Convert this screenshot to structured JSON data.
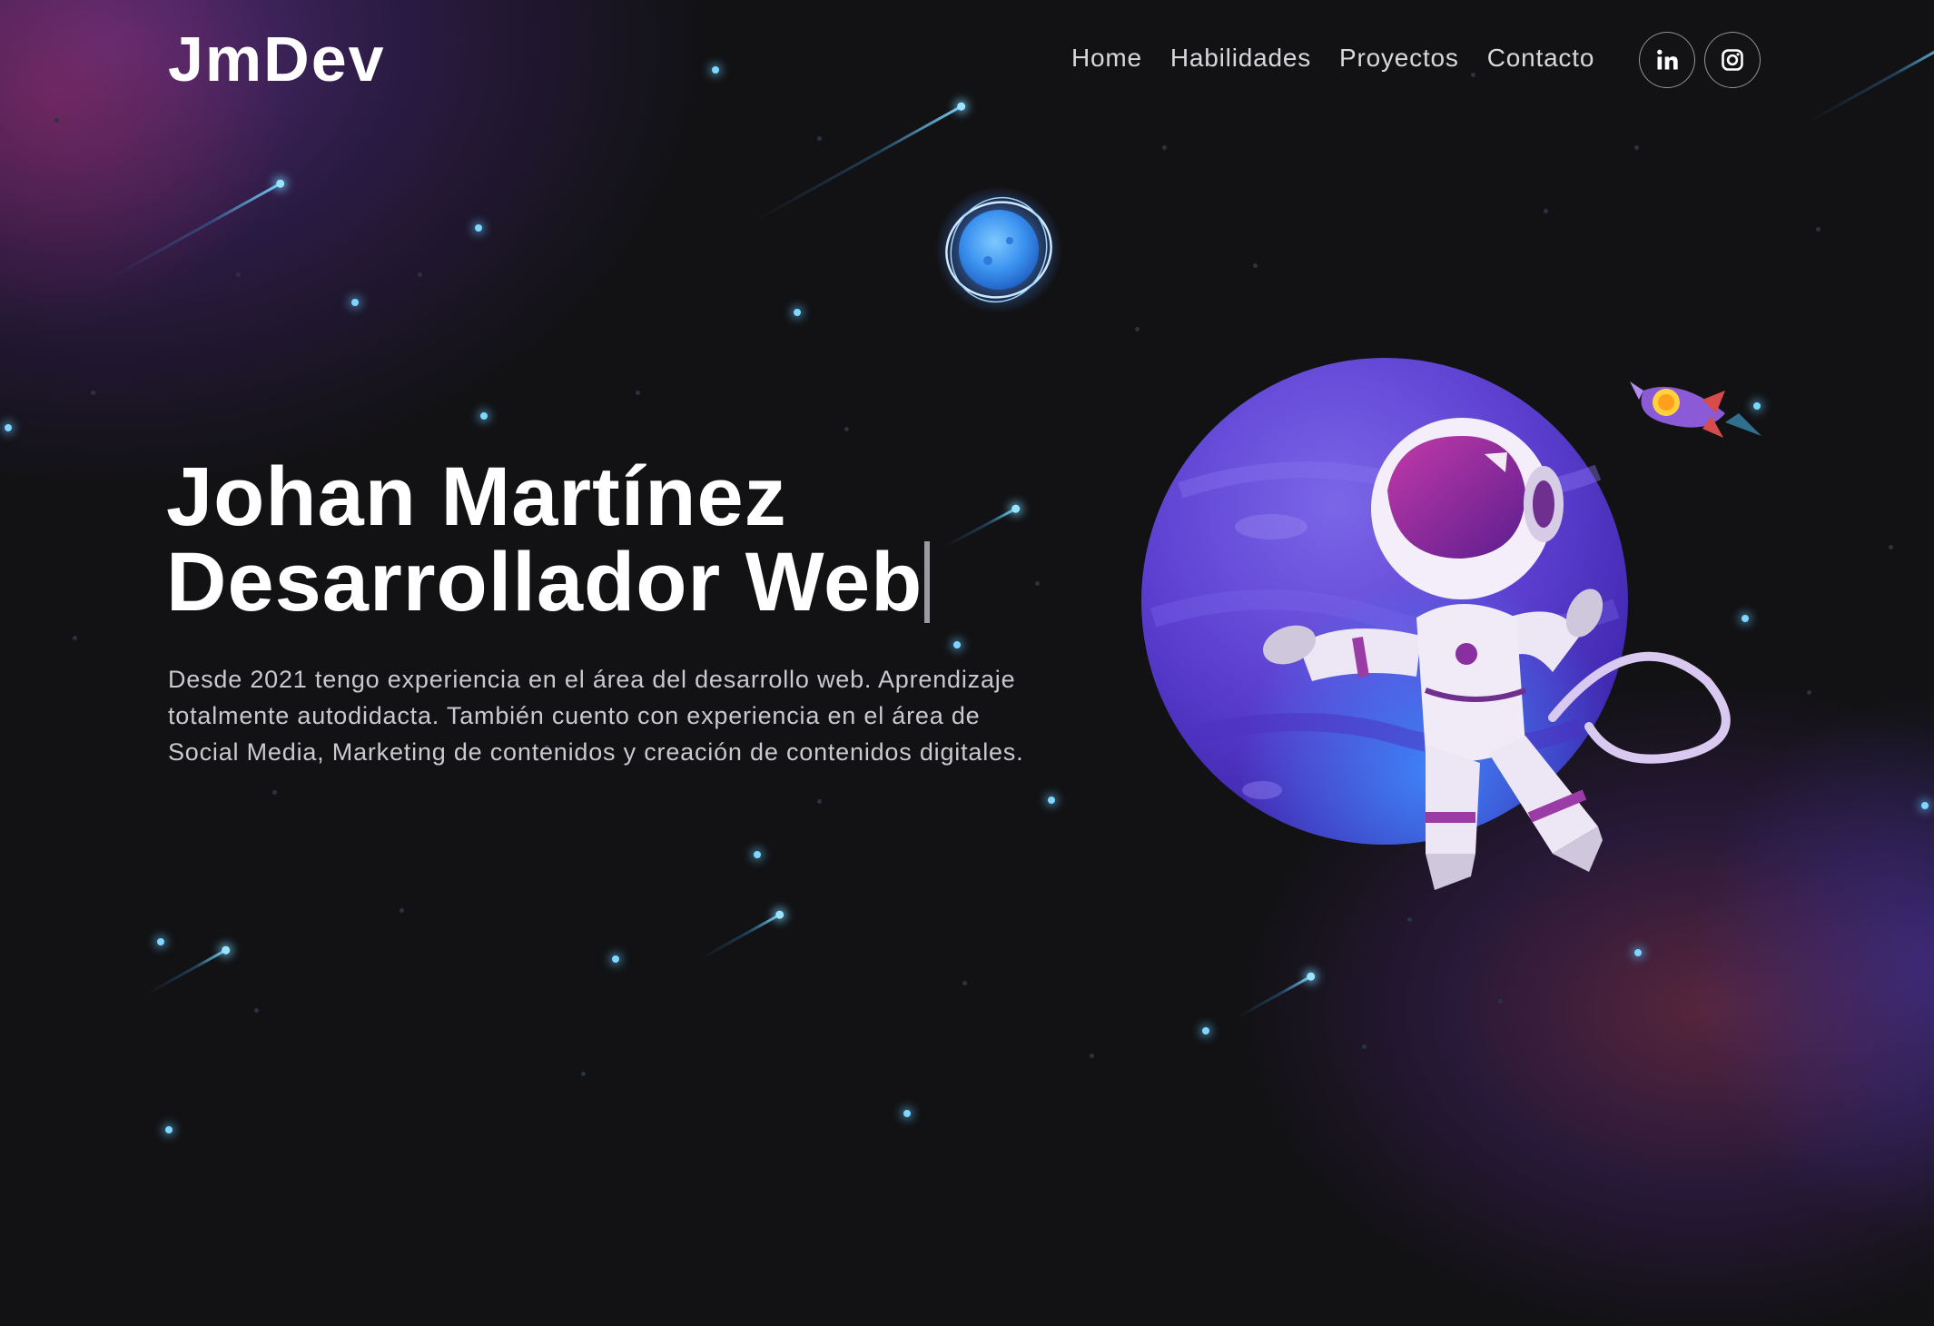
{
  "nav": {
    "logo": "JmDev",
    "links": [
      {
        "label": "Home"
      },
      {
        "label": "Habilidades"
      },
      {
        "label": "Proyectos"
      },
      {
        "label": "Contacto"
      }
    ],
    "social": [
      {
        "icon": "linkedin-icon"
      },
      {
        "icon": "instagram-icon"
      }
    ]
  },
  "hero": {
    "title_line1": "Johan Martínez",
    "title_line2": "Desarrollador Web",
    "description": "Desde 2021 tengo experiencia en el área del desarrollo web. Aprendizaje totalmente autodidacta. También cuento con experiencia en el área de Social Media, Marketing de contenidos y creación de contenidos digitales."
  },
  "colors": {
    "background": "#121214",
    "star": "#7fd6ff",
    "planet": "#6a48d8",
    "accent_purple": "#7a3fb0"
  }
}
